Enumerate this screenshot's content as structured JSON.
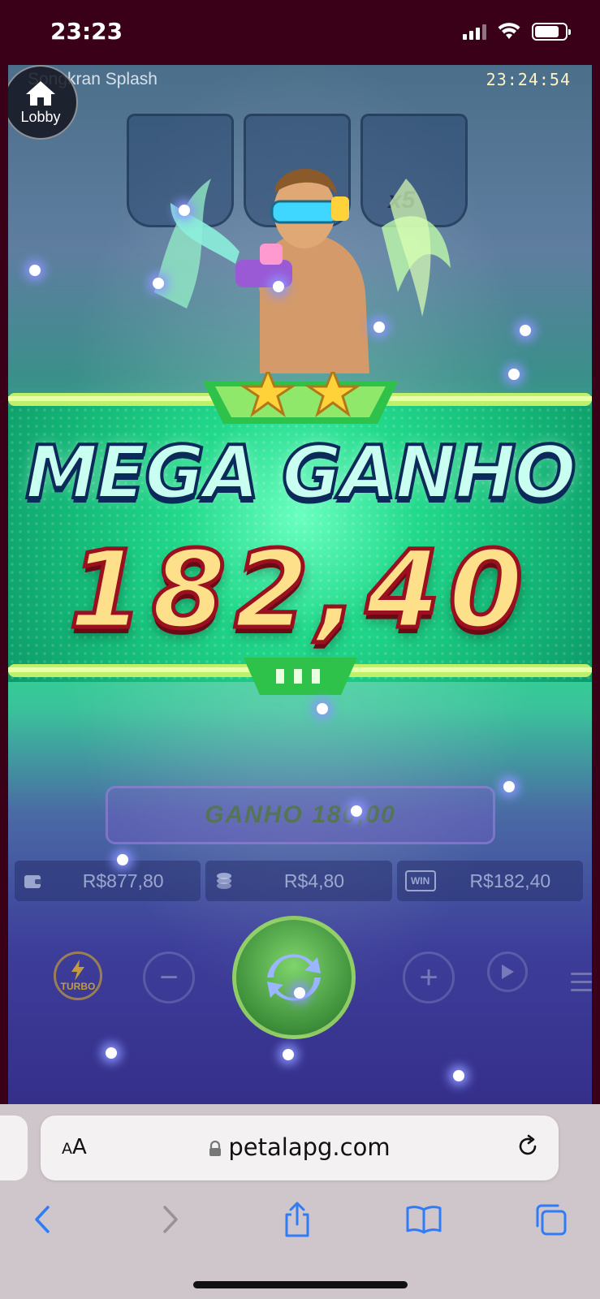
{
  "status_bar": {
    "time": "23:23"
  },
  "game": {
    "title": "Songkran Splash",
    "clock": "23:24:54",
    "lobby_label": "Lobby",
    "bucket_multiplier": "x5",
    "win_popup": {
      "headline": "MEGA GANHO",
      "amount": "182,40"
    },
    "win_bar_text": "GANHO 180,00",
    "balance": "R$877,80",
    "bet": "R$4,80",
    "win": "R$182,40",
    "win_badge": "WIN",
    "turbo_label": "TURBO",
    "minus_label": "−",
    "plus_label": "+"
  },
  "browser": {
    "aa_label_small": "A",
    "aa_label_large": "A",
    "url": "petalapg.com"
  },
  "colors": {
    "status_bar_bg": "#3a0018",
    "browser_bg": "#cfc6cc",
    "accent_blue": "#2f7cf6"
  }
}
